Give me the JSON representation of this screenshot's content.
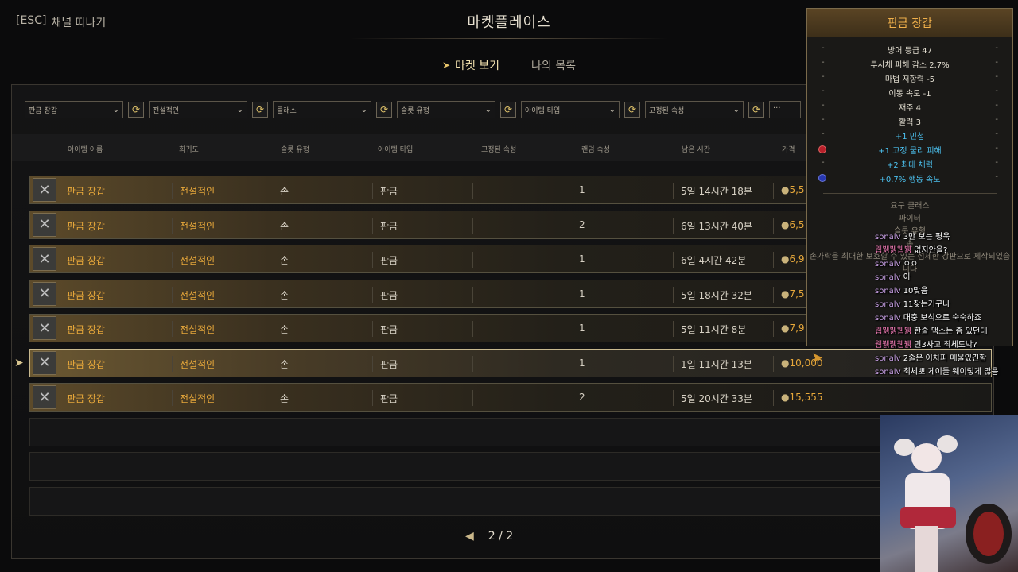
{
  "esc": {
    "key": "[ESC]",
    "label": "채널 떠나기"
  },
  "title": "마켓플레이스",
  "tabs": [
    {
      "label": "마켓 보기"
    },
    {
      "label": "나의 목록"
    }
  ],
  "filters": [
    {
      "label": "판금 장갑"
    },
    {
      "label": "전설적인"
    },
    {
      "label": "클래스"
    },
    {
      "label": "슬롯 유형"
    },
    {
      "label": "아이템 타입"
    },
    {
      "label": "고정된 속성"
    },
    {
      "label": "..."
    }
  ],
  "columns": [
    "아이템 이름",
    "희귀도",
    "슬롯 유형",
    "아이템 타입",
    "고정된 속성",
    "랜덤 속성",
    "남은 시간",
    "가격"
  ],
  "rows": [
    {
      "name": "판금 장갑",
      "rarity": "전설적인",
      "slot": "손",
      "type": "판금",
      "random": "1",
      "time": "5일 14시간 18분",
      "price": "5,5"
    },
    {
      "name": "판금 장갑",
      "rarity": "전설적인",
      "slot": "손",
      "type": "판금",
      "random": "2",
      "time": "6일 13시간 40분",
      "price": "6,5"
    },
    {
      "name": "판금 장갑",
      "rarity": "전설적인",
      "slot": "손",
      "type": "판금",
      "random": "1",
      "time": "6일 4시간 42분",
      "price": "6,9"
    },
    {
      "name": "판금 장갑",
      "rarity": "전설적인",
      "slot": "손",
      "type": "판금",
      "random": "1",
      "time": "5일 18시간 32분",
      "price": "7,5"
    },
    {
      "name": "판금 장갑",
      "rarity": "전설적인",
      "slot": "손",
      "type": "판금",
      "random": "1",
      "time": "5일 11시간 8분",
      "price": "7,9"
    },
    {
      "name": "판금 장갑",
      "rarity": "전설적인",
      "slot": "손",
      "type": "판금",
      "random": "1",
      "time": "1일 11시간 13분",
      "price": "10,000"
    },
    {
      "name": "판금 장갑",
      "rarity": "전설적인",
      "slot": "손",
      "type": "판금",
      "random": "2",
      "time": "5일 20시간 33분",
      "price": "15,555"
    }
  ],
  "pager": {
    "text": "2 / 2"
  },
  "tooltip": {
    "title": "판금 장갑",
    "stats": [
      "방어 등급 47",
      "투사체 피해 감소 2.7%",
      "마법 저항력 -5",
      "이동 속도 -1",
      "재주 4",
      "활력 3"
    ],
    "bonuses": [
      "+1 민첩",
      "+1 고정 물리 피해",
      "+2 최대 체력",
      "+0.7% 행동 속도"
    ],
    "faded": [
      "요구 클래스",
      "파이터",
      "슬롯 유형",
      "손"
    ],
    "desc": "손가락을 최대한 보호할 수 있는 섬세한 강판으로 제작되었습니다"
  },
  "chat": [
    {
      "user": "sonalv",
      "msg": "3만 보는 평욱"
    },
    {
      "user": "웹뷁뷁웹뷁",
      "msg": "없지안을?"
    },
    {
      "user": "sonalv",
      "msg": "ㅇㅇ"
    },
    {
      "user": "sonalv",
      "msg": "아"
    },
    {
      "user": "sonalv",
      "msg": "10맞음"
    },
    {
      "user": "sonalv",
      "msg": "11찾는거구나"
    },
    {
      "user": "sonalv",
      "msg": "대충 보석으로 숙숙하죠"
    },
    {
      "user": "웹뷁뷁웹뷁",
      "msg": "한줄 맥스는 좀 있던데"
    },
    {
      "user": "웹뷁뷁웹뷁",
      "msg": "민3사고 최체도박?"
    },
    {
      "user": "sonalv",
      "msg": "2줄은 어차피 매물있긴함"
    },
    {
      "user": "sonalv",
      "msg": "최체뽀 게이들 웨이렇게 많음"
    }
  ]
}
